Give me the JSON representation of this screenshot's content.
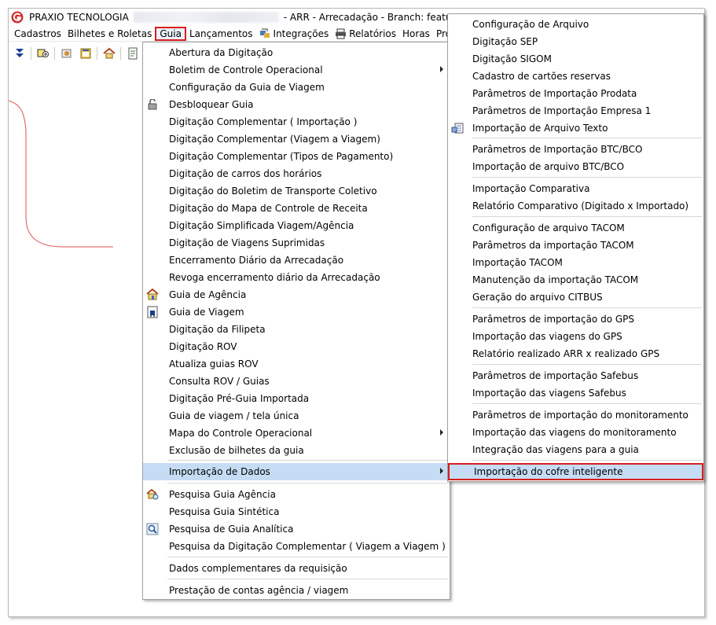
{
  "titlebar": {
    "company": "PRAXIO TECNOLOGIA",
    "rest": "- ARR - Arrecadação - Branch: feature/AR"
  },
  "menubar": {
    "items": [
      {
        "label": "Cadastros",
        "icon": null
      },
      {
        "label": "Bilhetes e Roletas",
        "icon": null
      },
      {
        "label": "Guia",
        "icon": null
      },
      {
        "label": "Lançamentos",
        "icon": null
      },
      {
        "label": "Integrações",
        "icon": "integration-icon"
      },
      {
        "label": "Relatórios",
        "icon": "printer-icon"
      },
      {
        "label": "Horas",
        "icon": null
      },
      {
        "label": "Proced",
        "icon": null
      }
    ]
  },
  "toolbar": {
    "icons": [
      "double-down-arrow-icon",
      "user-group-icon",
      "tools-icon",
      "calendar-icon",
      "home-icon",
      "document-icon"
    ]
  },
  "guia_menu": {
    "items": [
      {
        "label": "Abertura da Digitação"
      },
      {
        "label": "Boletim de Controle Operacional",
        "submenu": true
      },
      {
        "label": "Configuração da Guia de Viagem"
      },
      {
        "label": "Desbloquear Guia",
        "icon": "unlock-icon"
      },
      {
        "label": "Digitação Complementar ( Importação )"
      },
      {
        "label": "Digitação Complementar (Viagem a Viagem)"
      },
      {
        "label": "Digitação Complementar (Tipos de Pagamento)"
      },
      {
        "label": "Digitação de carros dos horários"
      },
      {
        "label": "Digitação do Boletim de Transporte Coletivo"
      },
      {
        "label": "Digitação do Mapa de Controle de Receita"
      },
      {
        "label": "Digitação Simplificada Viagem/Agência"
      },
      {
        "label": "Digitação de Viagens Suprimidas"
      },
      {
        "label": "Encerramento Diário da Arrecadação"
      },
      {
        "label": "Revoga encerramento diário da Arrecadação"
      },
      {
        "label": "Guia de Agência",
        "icon": "agency-icon"
      },
      {
        "label": "Guia de Viagem",
        "icon": "bus-guide-icon"
      },
      {
        "label": "Digitação da Filipeta"
      },
      {
        "label": "Digitação ROV"
      },
      {
        "label": "Atualiza guias ROV"
      },
      {
        "label": "Consulta ROV / Guias"
      },
      {
        "label": "Digitação Pré-Guia Importada"
      },
      {
        "label": "Guia de viagem / tela única"
      },
      {
        "label": "Mapa do Controle Operacional",
        "submenu": true
      },
      {
        "label": "Exclusão de bilhetes da guia"
      },
      {
        "label": "Importação de Dados",
        "submenu": true,
        "highlighted": true
      },
      {
        "label": "Pesquisa Guia Agência",
        "icon": "search-agency-icon"
      },
      {
        "label": "Pesquisa Guia Sintética"
      },
      {
        "label": "Pesquisa de Guia Analítica",
        "icon": "magnifier-icon"
      },
      {
        "label": "Pesquisa da Digitação Complementar ( Viagem a Viagem )"
      },
      {
        "label": "Dados complementares da requisição"
      },
      {
        "label": "Prestação de contas agência / viagem"
      }
    ]
  },
  "import_submenu": {
    "items": [
      {
        "label": "Configuração de Arquivo"
      },
      {
        "label": "Digitação SEP"
      },
      {
        "label": "Digitação SIGOM"
      },
      {
        "label": "Cadastro de cartões reservas"
      },
      {
        "label": "Parâmetros de Importação Prodata"
      },
      {
        "label": "Parâmetros de Importação Empresa 1"
      },
      {
        "label": "Importação de Arquivo Texto",
        "icon": "text-import-icon"
      },
      {
        "label": "Parâmetros de Importação BTC/BCO"
      },
      {
        "label": "Importação de arquivo BTC/BCO"
      },
      {
        "label": "Importação Comparativa"
      },
      {
        "label": "Relatório Comparativo (Digitado x Importado)"
      },
      {
        "label": "Configuração de arquivo TACOM"
      },
      {
        "label": "Parâmetros da importação TACOM"
      },
      {
        "label": "Importação TACOM"
      },
      {
        "label": "Manutenção da importação TACOM"
      },
      {
        "label": "Geração do arquivo CITBUS"
      },
      {
        "label": "Parâmetros de importação do GPS"
      },
      {
        "label": "Importação das viagens do GPS"
      },
      {
        "label": "Relatório realizado ARR x realizado GPS"
      },
      {
        "label": "Parâmetros de importação Safebus"
      },
      {
        "label": "Importação das viagens Safebus"
      },
      {
        "label": "Parâmetros de importação do monitoramento"
      },
      {
        "label": "Importação das viagens do monitoramento"
      },
      {
        "label": "Integração das viagens para a guia"
      },
      {
        "label": "Importação do cofre inteligente",
        "highlighted": true
      }
    ]
  },
  "colors": {
    "highlight": "#c5dcf4",
    "annotation_red": "#d81e1e",
    "logo_red": "#d42a2a"
  }
}
